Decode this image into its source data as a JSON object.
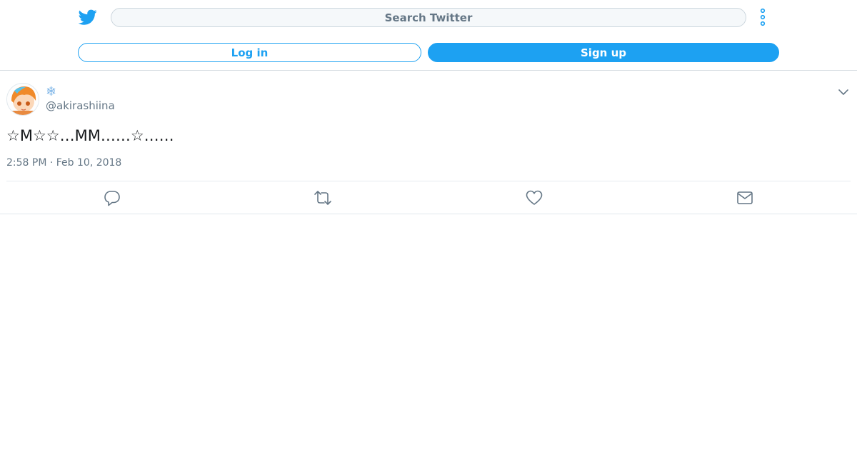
{
  "header": {
    "logo_icon": "twitter-bird-icon",
    "search": {
      "placeholder": "Search Twitter"
    },
    "more_icon": "vertical-dots-icon",
    "login_label": "Log in",
    "signup_label": "Sign up",
    "accent_color": "#1da1f2"
  },
  "tweet": {
    "author": {
      "display_name": "❄",
      "handle": "@akirashiina",
      "avatar_icon": "avatar-image"
    },
    "text": "☆M☆☆…MM……☆……",
    "timestamp": "2:58 PM · Feb 10, 2018",
    "menu_icon": "chevron-down-icon",
    "actions": [
      {
        "name": "reply",
        "icon": "reply-icon"
      },
      {
        "name": "retweet",
        "icon": "retweet-icon"
      },
      {
        "name": "like",
        "icon": "heart-icon"
      },
      {
        "name": "share",
        "icon": "mail-icon"
      }
    ]
  }
}
